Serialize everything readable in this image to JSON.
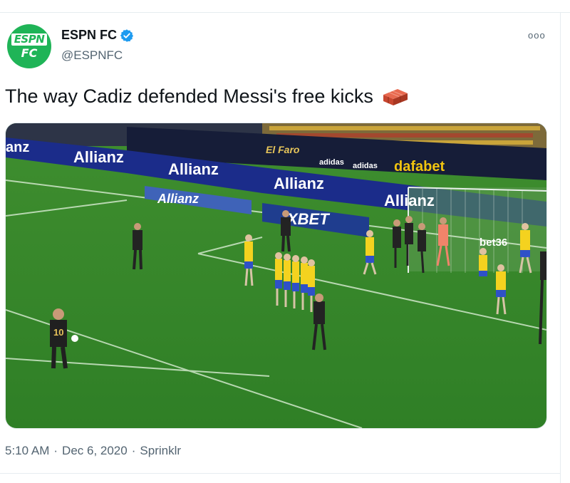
{
  "account": {
    "display_name": "ESPN FC",
    "handle": "@ESPNFC",
    "avatar_line1": "ESPN",
    "avatar_line2": "FC",
    "verified": true,
    "verified_icon": "verified-badge-icon",
    "brand_color": "#1fb457",
    "verified_color": "#1d9bf0"
  },
  "menu": {
    "more_icon": "ooo"
  },
  "tweet": {
    "text": "The way Cadiz defended Messi's free kicks",
    "emoji_icon": "brick-icon"
  },
  "media": {
    "description_icon": "football-free-kick-photo",
    "boards": {
      "allianz": "Allianz",
      "allianz_left_cut": "anz",
      "elfaro": "El Faro",
      "adidas": "adidas",
      "dafabet": "dafabet",
      "xbet": "XBET",
      "bet": "bet36"
    },
    "messi_number": "10"
  },
  "meta": {
    "time": "5:10 AM",
    "separator": "·",
    "date": "Dec 6, 2020",
    "source": "Sprinklr"
  }
}
